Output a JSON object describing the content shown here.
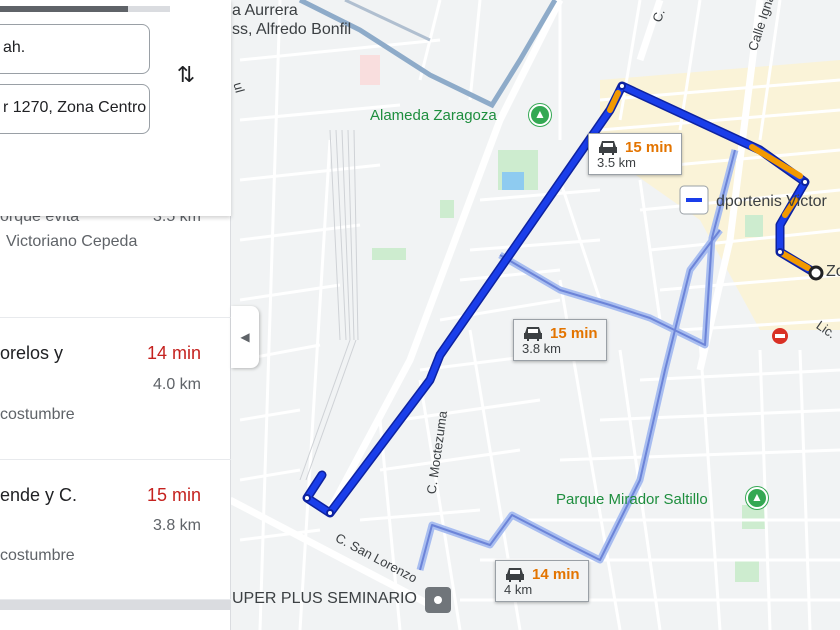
{
  "map": {
    "labels": {
      "aurrera": "a Aurrera",
      "bonfil": "ss, Alfredo Bonfil",
      "alameda": "Alameda Zaragoza",
      "c_top": "C.",
      "ignacio_allende": "Calle Ignacio Allende",
      "deportenis": "dportenis Victor",
      "zona": "Zo",
      "lic": "Lic.",
      "moctezuma": "C. Moctezuma",
      "san_lorenzo": "C. San Lorenzo",
      "parque_mirador": "Parque Mirador Saltillo",
      "super_plus": "UPER PLUS SEMINARIO",
      "leaked_label": "ul"
    },
    "route_cards": [
      {
        "time": "15 min",
        "distance": "3.5 km"
      },
      {
        "time": "15 min",
        "distance": "3.8 km"
      },
      {
        "time": "14 min",
        "distance": "4 km"
      }
    ],
    "colors": {
      "primary_route": "#1a3eea",
      "alt_route": "#a8bdf0",
      "traffic": "#f29900"
    }
  },
  "panel": {
    "progress_fraction": 0.75,
    "origin_value": "ah.",
    "destination_value": "r 1270, Zona Centro",
    "swap_icon": "swap-vertical-icon",
    "routes": [
      {
        "title": "orque evita",
        "distance": "3.5 km",
        "via": "Victoriano Cepeda"
      },
      {
        "title": "orelos y",
        "time": "14 min",
        "distance": "4.0 km",
        "note": "costumbre"
      },
      {
        "title": "ende y C.",
        "time": "15 min",
        "distance": "3.8 km",
        "note": "costumbre"
      }
    ],
    "collapse_icon": "chevron-left-icon"
  }
}
